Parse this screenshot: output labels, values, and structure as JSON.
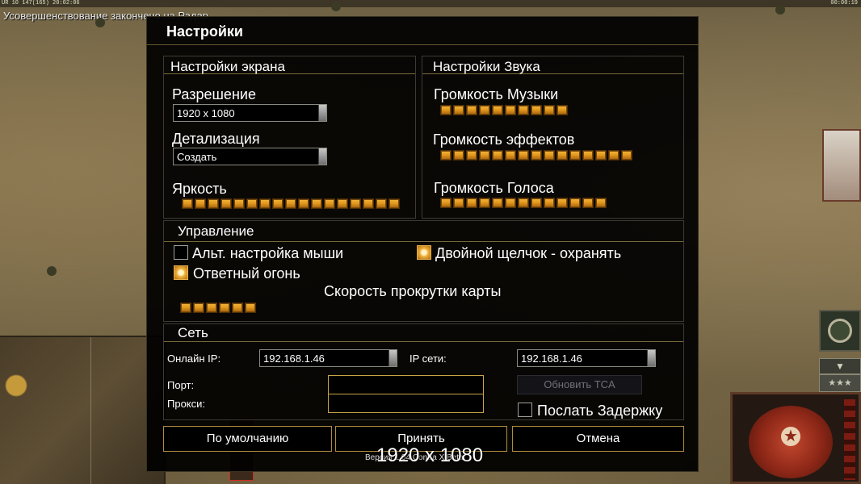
{
  "hud": {
    "status_line": "UR 10 147(165) 20:02:06",
    "timer": "00:00:19",
    "notice": "Усовершенствование закончено на Радар"
  },
  "dialog": {
    "title": "Настройки"
  },
  "display": {
    "group_title": "Настройки экрана",
    "resolution_label": "Разрешение",
    "resolution_value": "1920 x 1080",
    "detail_label": "Детализация",
    "detail_value": "Создать",
    "brightness_label": "Яркость",
    "brightness_level": 17,
    "brightness_segments": 17
  },
  "sound": {
    "group_title": "Настройки Звука",
    "music_label": "Громкость Музыки",
    "music_level": 10,
    "effects_label": "Громкость эффектов",
    "effects_level": 15,
    "voice_label": "Громкость Голоса",
    "voice_level": 13
  },
  "controls": {
    "group_title": "Управление",
    "alt_mouse_label": "Альт. настройка мыши",
    "alt_mouse_checked": false,
    "double_click_label": "Двойной щелчок - охранять",
    "double_click_checked": true,
    "retaliation_label": "Ответный огонь",
    "retaliation_checked": true,
    "scroll_speed_label": "Скорость прокрутки карты",
    "scroll_speed_level": 6
  },
  "network": {
    "group_title": "Сеть",
    "online_ip_label": "Онлайн IP:",
    "online_ip_value": "192.168.1.46",
    "lan_ip_label": "IP сети:",
    "lan_ip_value": "192.168.1.46",
    "port_label": "Порт:",
    "port_value": "",
    "proxy_label": "Прокси:",
    "proxy_value": "",
    "refresh_tca_label": "Обновить TCA",
    "send_delay_label": "Послать Задержку",
    "send_delay_checked": false
  },
  "buttons": {
    "defaults": "По умолчанию",
    "accept": "Принять",
    "cancel": "Отмена"
  },
  "footer": {
    "version": "Версия 1.04 Contra X Beta",
    "tooltip": "1920 x 1080"
  },
  "colors": {
    "slider_segment": "#f0a52a",
    "frame_gold": "#b08d3e",
    "dialog_bg": "#000000"
  }
}
